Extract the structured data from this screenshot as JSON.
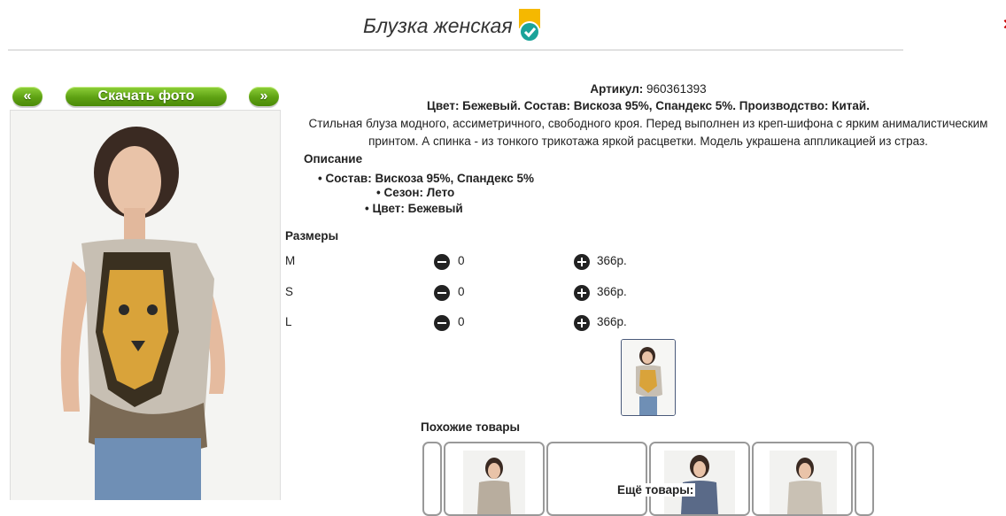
{
  "product": {
    "title": "Блузка женская",
    "article_label": "Артикул:",
    "article_value": "960361393",
    "composition_line": "Цвет: Бежевый. Состав: Вискоза 95%, Спандекс 5%. Производство: Китай.",
    "description_line1": "Стильная блуза модного, ассиметричного, свободного кроя. Перед выполнен из креп-шифона с ярким анималистическим",
    "description_line2": "принтом. А спинка - из тонкого трикотажа яркой расцветки. Модель украшена аппликацией из страз.",
    "description_heading": "Описание",
    "bullets": [
      "Состав: Вискоза 95%, Спандекс 5%",
      "Сезон: Лето",
      "Цвет: Бежевый"
    ]
  },
  "gallery": {
    "prev_label": "«",
    "download_label": "Скачать фото",
    "next_label": "»"
  },
  "sizes": {
    "heading": "Размеры",
    "rows": [
      {
        "size": "M",
        "qty": "0",
        "price": "366р."
      },
      {
        "size": "S",
        "qty": "0",
        "price": "366р."
      },
      {
        "size": "L",
        "qty": "0",
        "price": "366р."
      }
    ]
  },
  "similar": {
    "heading": "Похожие товары",
    "more_label": "Ещё товары:"
  },
  "colors": {
    "accent_green": "#5ea113",
    "badge_yellow": "#f5b800",
    "badge_teal": "#1aa39a"
  },
  "icons": [
    "verified-badge-icon",
    "minus-circle-icon",
    "plus-circle-icon"
  ]
}
